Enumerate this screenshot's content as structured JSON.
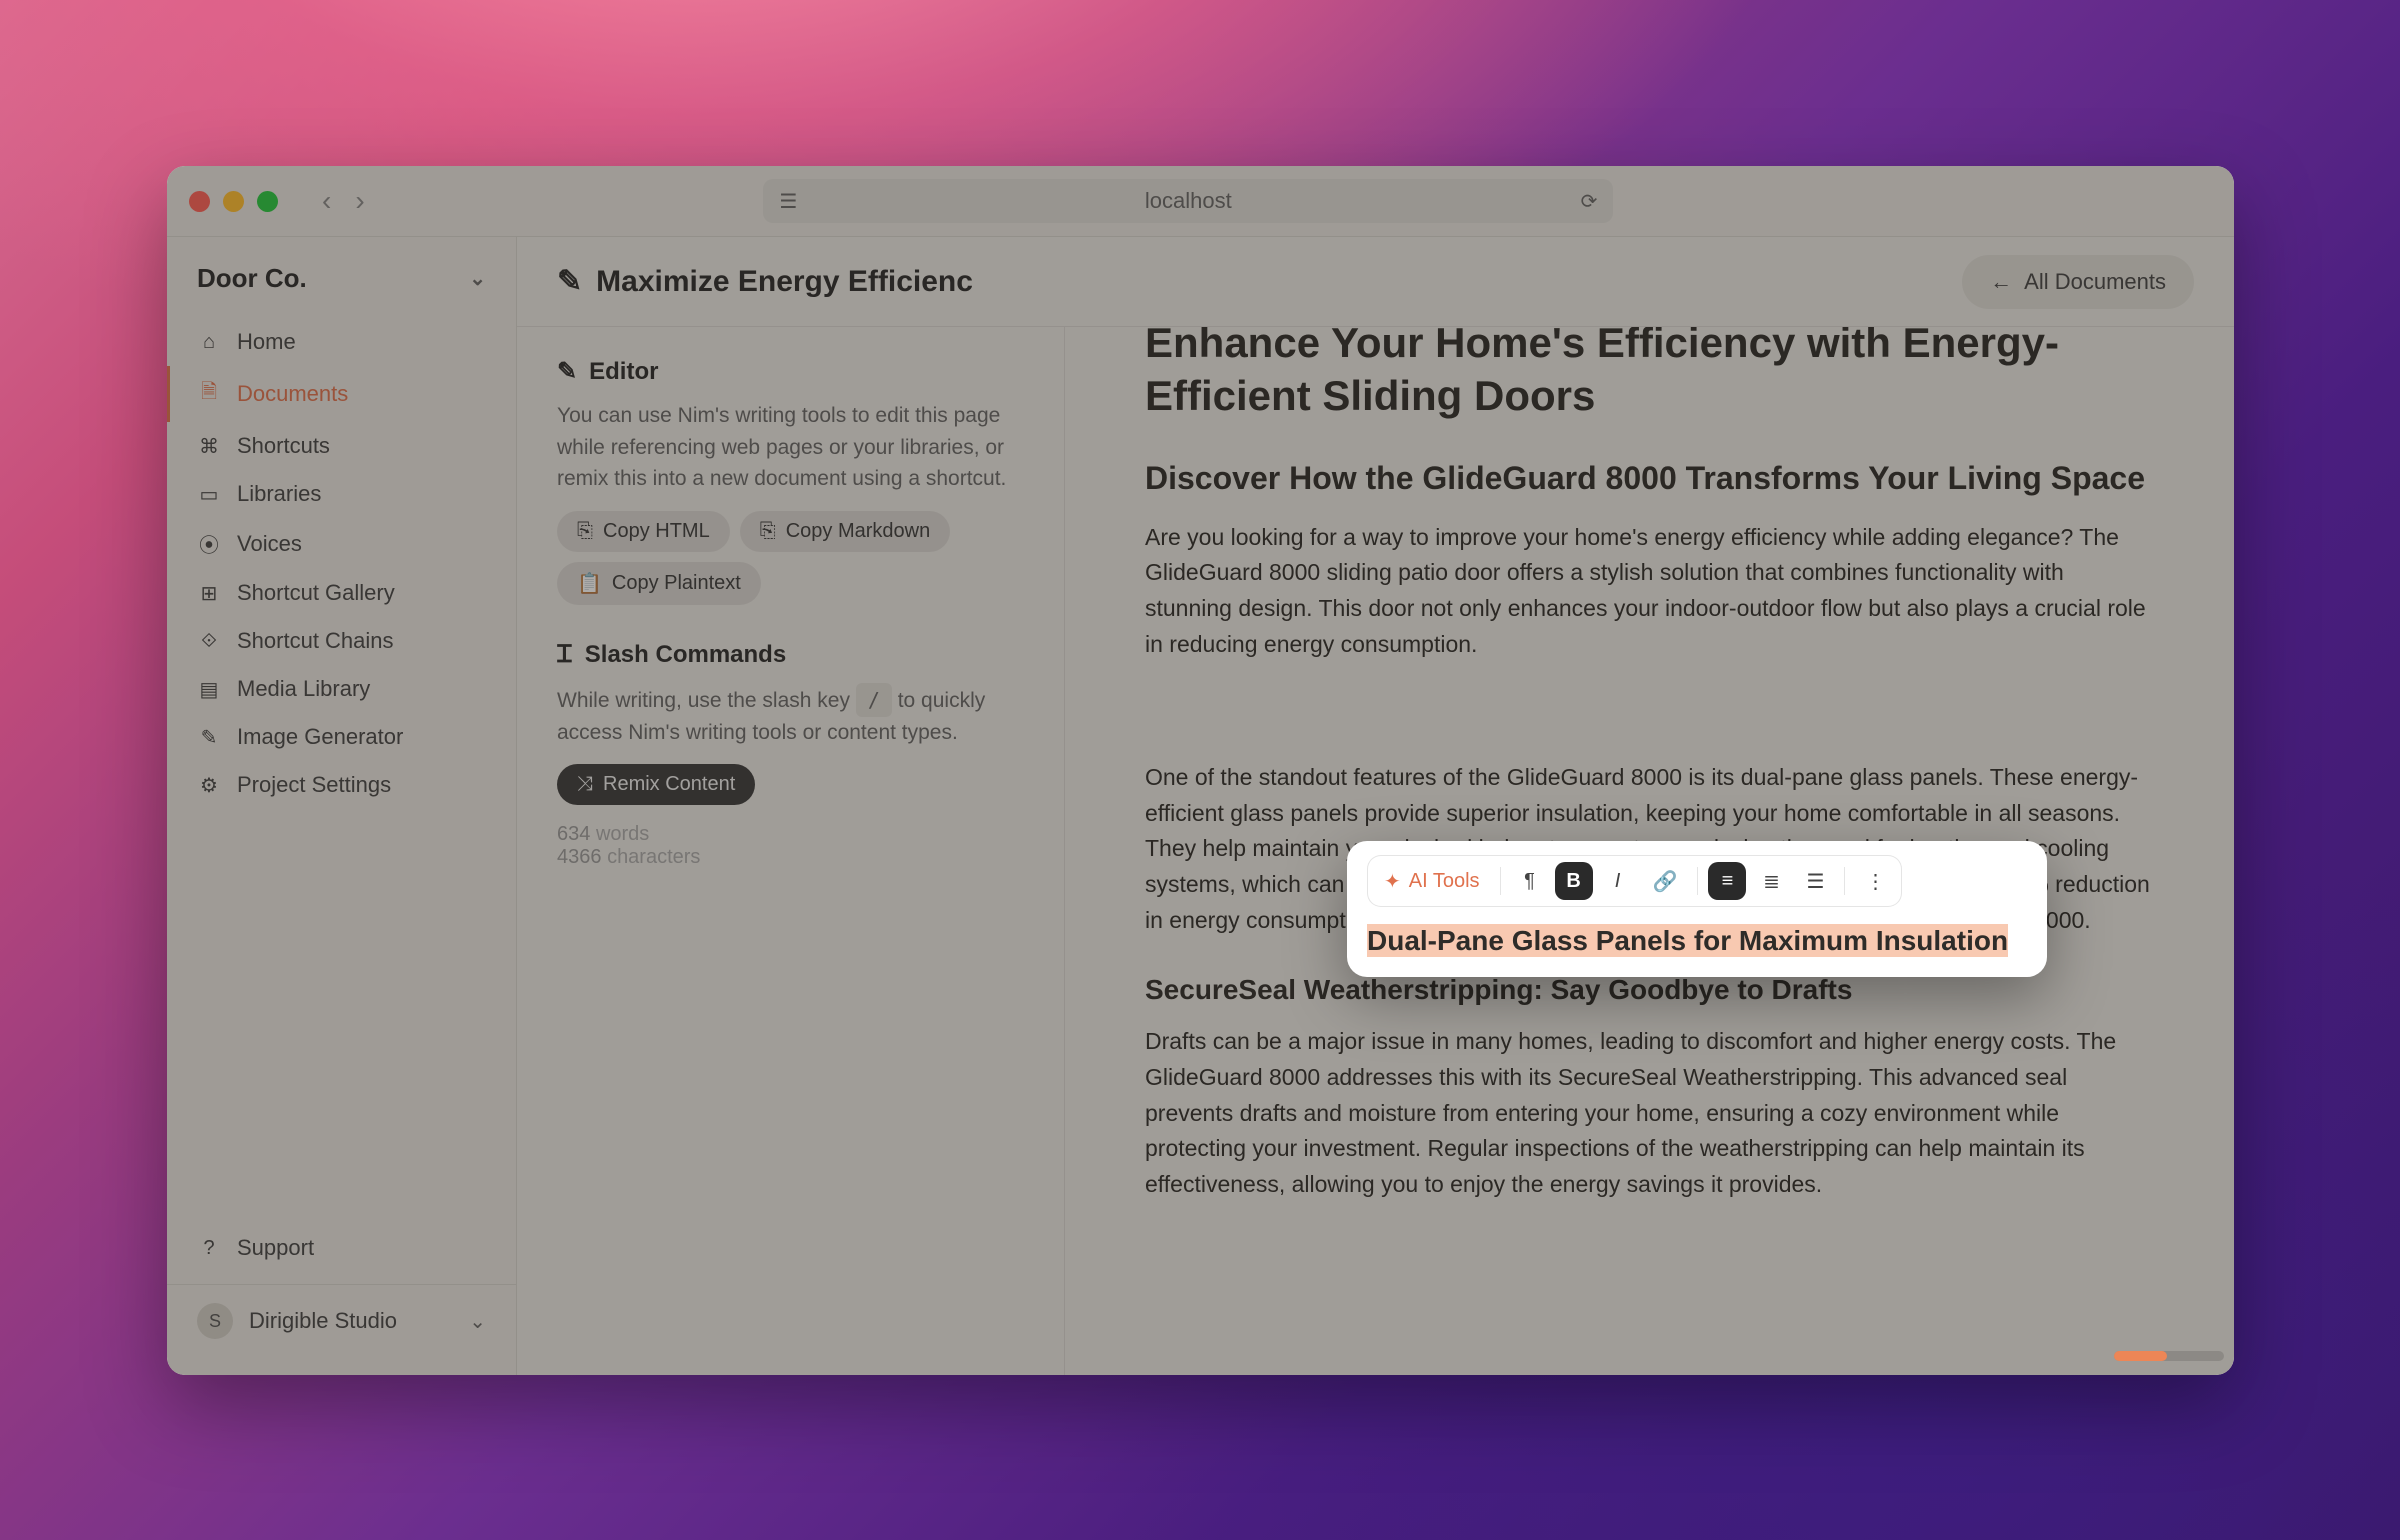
{
  "browser": {
    "url": "localhost"
  },
  "sidebar": {
    "workspace": "Door Co.",
    "items": [
      {
        "icon": "home-icon",
        "glyph": "⌂",
        "label": "Home"
      },
      {
        "icon": "documents-icon",
        "glyph": "🗎",
        "label": "Documents",
        "active": true
      },
      {
        "icon": "shortcuts-icon",
        "glyph": "⌘",
        "label": "Shortcuts"
      },
      {
        "icon": "libraries-icon",
        "glyph": "▭",
        "label": "Libraries"
      },
      {
        "icon": "voices-icon",
        "glyph": "⦿",
        "label": "Voices"
      },
      {
        "icon": "shortcut-gallery-icon",
        "glyph": "⊞",
        "label": "Shortcut Gallery"
      },
      {
        "icon": "shortcut-chains-icon",
        "glyph": "⟐",
        "label": "Shortcut Chains"
      },
      {
        "icon": "media-library-icon",
        "glyph": "▤",
        "label": "Media Library"
      },
      {
        "icon": "image-generator-icon",
        "glyph": "✎",
        "label": "Image Generator"
      },
      {
        "icon": "project-settings-icon",
        "glyph": "⚙",
        "label": "Project Settings"
      }
    ],
    "support": {
      "icon": "support-icon",
      "glyph": "?",
      "label": "Support"
    },
    "user_initial": "S",
    "user_name": "Dirigible Studio"
  },
  "header": {
    "title": "Maximize Energy Efficienc",
    "all_docs": "All Documents"
  },
  "inspector": {
    "editor_h": "Editor",
    "editor_p": "You can use Nim's writing tools to edit this page while referencing web pages or your libraries, or remix this into a new document using a shortcut.",
    "copy_html": "Copy HTML",
    "copy_md": "Copy Markdown",
    "copy_plain": "Copy Plaintext",
    "slash_h": "Slash Commands",
    "slash_p1": "While writing, use the slash key",
    "slash_key": "/",
    "slash_p2": "to quickly access Nim's writing tools or content types.",
    "remix": "Remix Content",
    "words_n": "634",
    "words_l": "words",
    "chars_n": "4366",
    "chars_l": "characters"
  },
  "doc": {
    "h1": "Enhance Your Home's Efficiency with Energy-Efficient Sliding Doors",
    "h2": "Discover How the GlideGuard 8000 Transforms Your Living Space",
    "p1": "Are you looking for a way to improve your home's energy efficiency while adding elegance? The GlideGuard 8000 sliding patio door offers a stylish solution that combines functionality with stunning design. This door not only enhances your indoor-outdoor flow but also plays a crucial role in reducing energy consumption.",
    "h3a": "Dual-Pane Glass Panels for Maximum Insulation",
    "p2": "One of the standout features of the GlideGuard 8000 is its dual-pane glass panels. These energy-efficient glass panels provide superior insulation, keeping your home comfortable in all seasons. They help maintain your desired indoor temperature, reducing the need for heating and cooling systems, which can significantly lower your energy bills. Homeowners report up to a 30% reduction in energy consumption after installing energy-efficient sliding doors like the GlideGuard 8000.",
    "h3b": "SecureSeal Weatherstripping: Say Goodbye to Drafts",
    "p3": "Drafts can be a major issue in many homes, leading to discomfort and higher energy costs. The GlideGuard 8000 addresses this with its SecureSeal Weatherstripping. This advanced seal prevents drafts and moisture from entering your home, ensuring a cozy environment while protecting your investment. Regular inspections of the weatherstripping can help maintain its effectiveness, allowing you to enjoy the energy savings it provides."
  },
  "toolbar": {
    "ai": "AI Tools"
  },
  "progress_pct": 48
}
